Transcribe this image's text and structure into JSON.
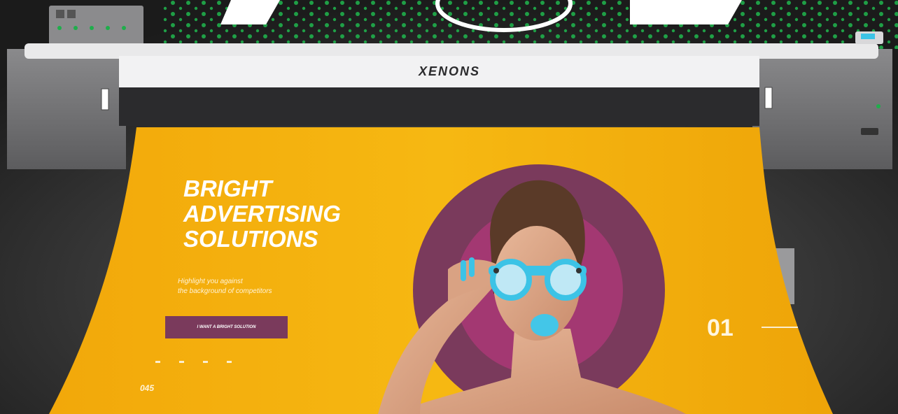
{
  "brand": "XENONS",
  "banner": {
    "headline_lines": [
      "BRIGHT",
      "ADVERTISING",
      "SOLUTIONS"
    ],
    "subtitle_lines": [
      "Highlight you against",
      "the background of competitors"
    ],
    "cta_label": "I WANT A BRIGHT SOLUTION",
    "slide_number": "01",
    "corner_code": "045"
  },
  "colors": {
    "banner_yellow": "#f6b40e",
    "accent_purple": "#7a3a5c",
    "dot_green": "#1fae4b",
    "lens_cyan": "#3cc3e6",
    "printer_body": "#6f6f71"
  }
}
